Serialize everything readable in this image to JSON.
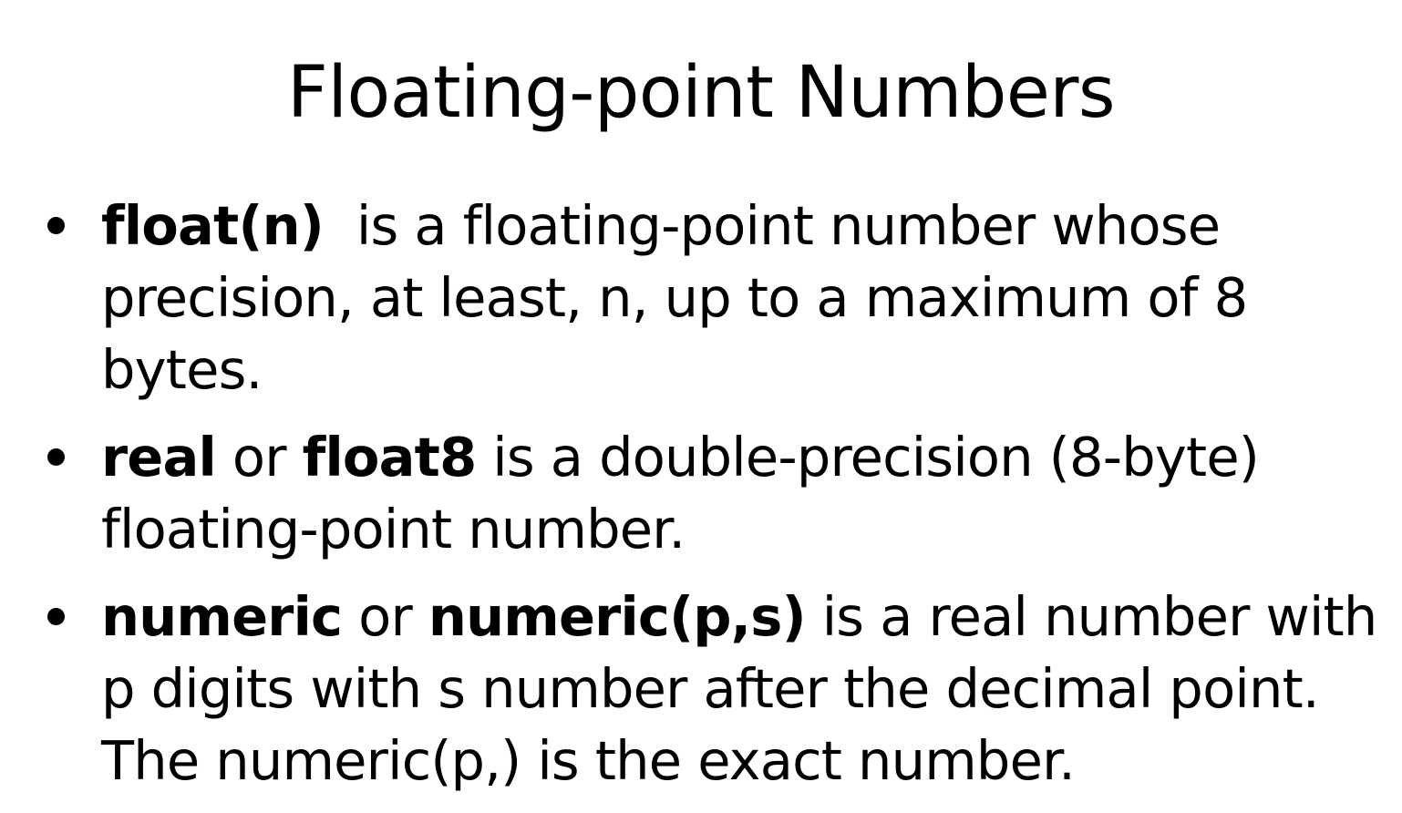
{
  "slide": {
    "title": "Floating-point Numbers",
    "bullets": [
      {
        "parts": [
          {
            "bold": true,
            "text": "float(n)"
          },
          {
            "bold": false,
            "text": "  is a floating-point number whose precision, at least, n, up to a maximum of 8 bytes."
          }
        ]
      },
      {
        "parts": [
          {
            "bold": true,
            "text": "real"
          },
          {
            "bold": false,
            "text": " or "
          },
          {
            "bold": true,
            "text": "float8"
          },
          {
            "bold": false,
            "text": " is a double-precision (8-byte) floating-point number."
          }
        ]
      },
      {
        "parts": [
          {
            "bold": true,
            "text": "numeric"
          },
          {
            "bold": false,
            "text": " or "
          },
          {
            "bold": true,
            "text": "numeric(p,s)"
          },
          {
            "bold": false,
            "text": " is a real number with p digits with s number after the decimal point. The numeric(p,) is the exact number."
          }
        ]
      }
    ]
  }
}
